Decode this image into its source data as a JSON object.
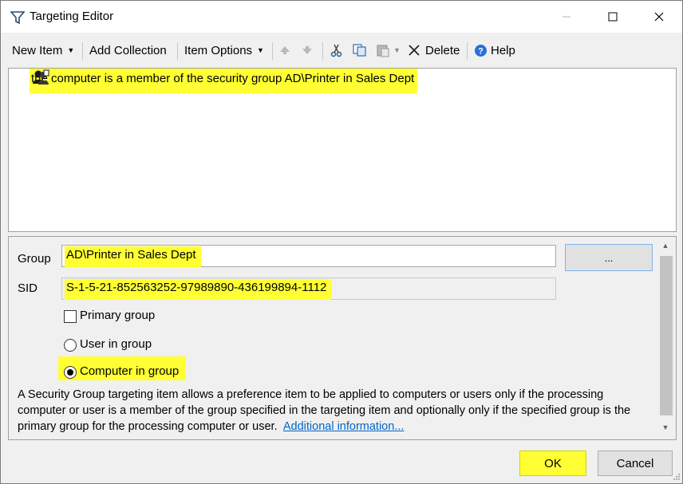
{
  "window": {
    "title": "Targeting Editor"
  },
  "toolbar": {
    "new_item": "New Item",
    "add_collection": "Add Collection",
    "item_options": "Item Options",
    "delete": "Delete",
    "help": "Help"
  },
  "tree": {
    "items": [
      {
        "label": "the computer is a member of the security group AD\\Printer in Sales Dept"
      }
    ]
  },
  "properties": {
    "group_label": "Group",
    "group_value": "AD\\Printer in Sales Dept",
    "browse_label": "...",
    "sid_label": "SID",
    "sid_value": "S-1-5-21-852563252-97989890-436199894-1112",
    "primary_group_label": "Primary group",
    "user_in_group_label": "User in group",
    "computer_in_group_label": "Computer in group",
    "description": "A Security Group targeting item allows a preference item to be applied to computers or users only if the processing computer or user is a member of the group specified in the targeting item and optionally only if the specified group is the primary group for the processing computer or user.",
    "additional_info_link": "Additional information..."
  },
  "buttons": {
    "ok": "OK",
    "cancel": "Cancel"
  },
  "colors": {
    "highlight": "#ffff33",
    "link": "#0066cc",
    "help_icon": "#2a6fd6"
  }
}
